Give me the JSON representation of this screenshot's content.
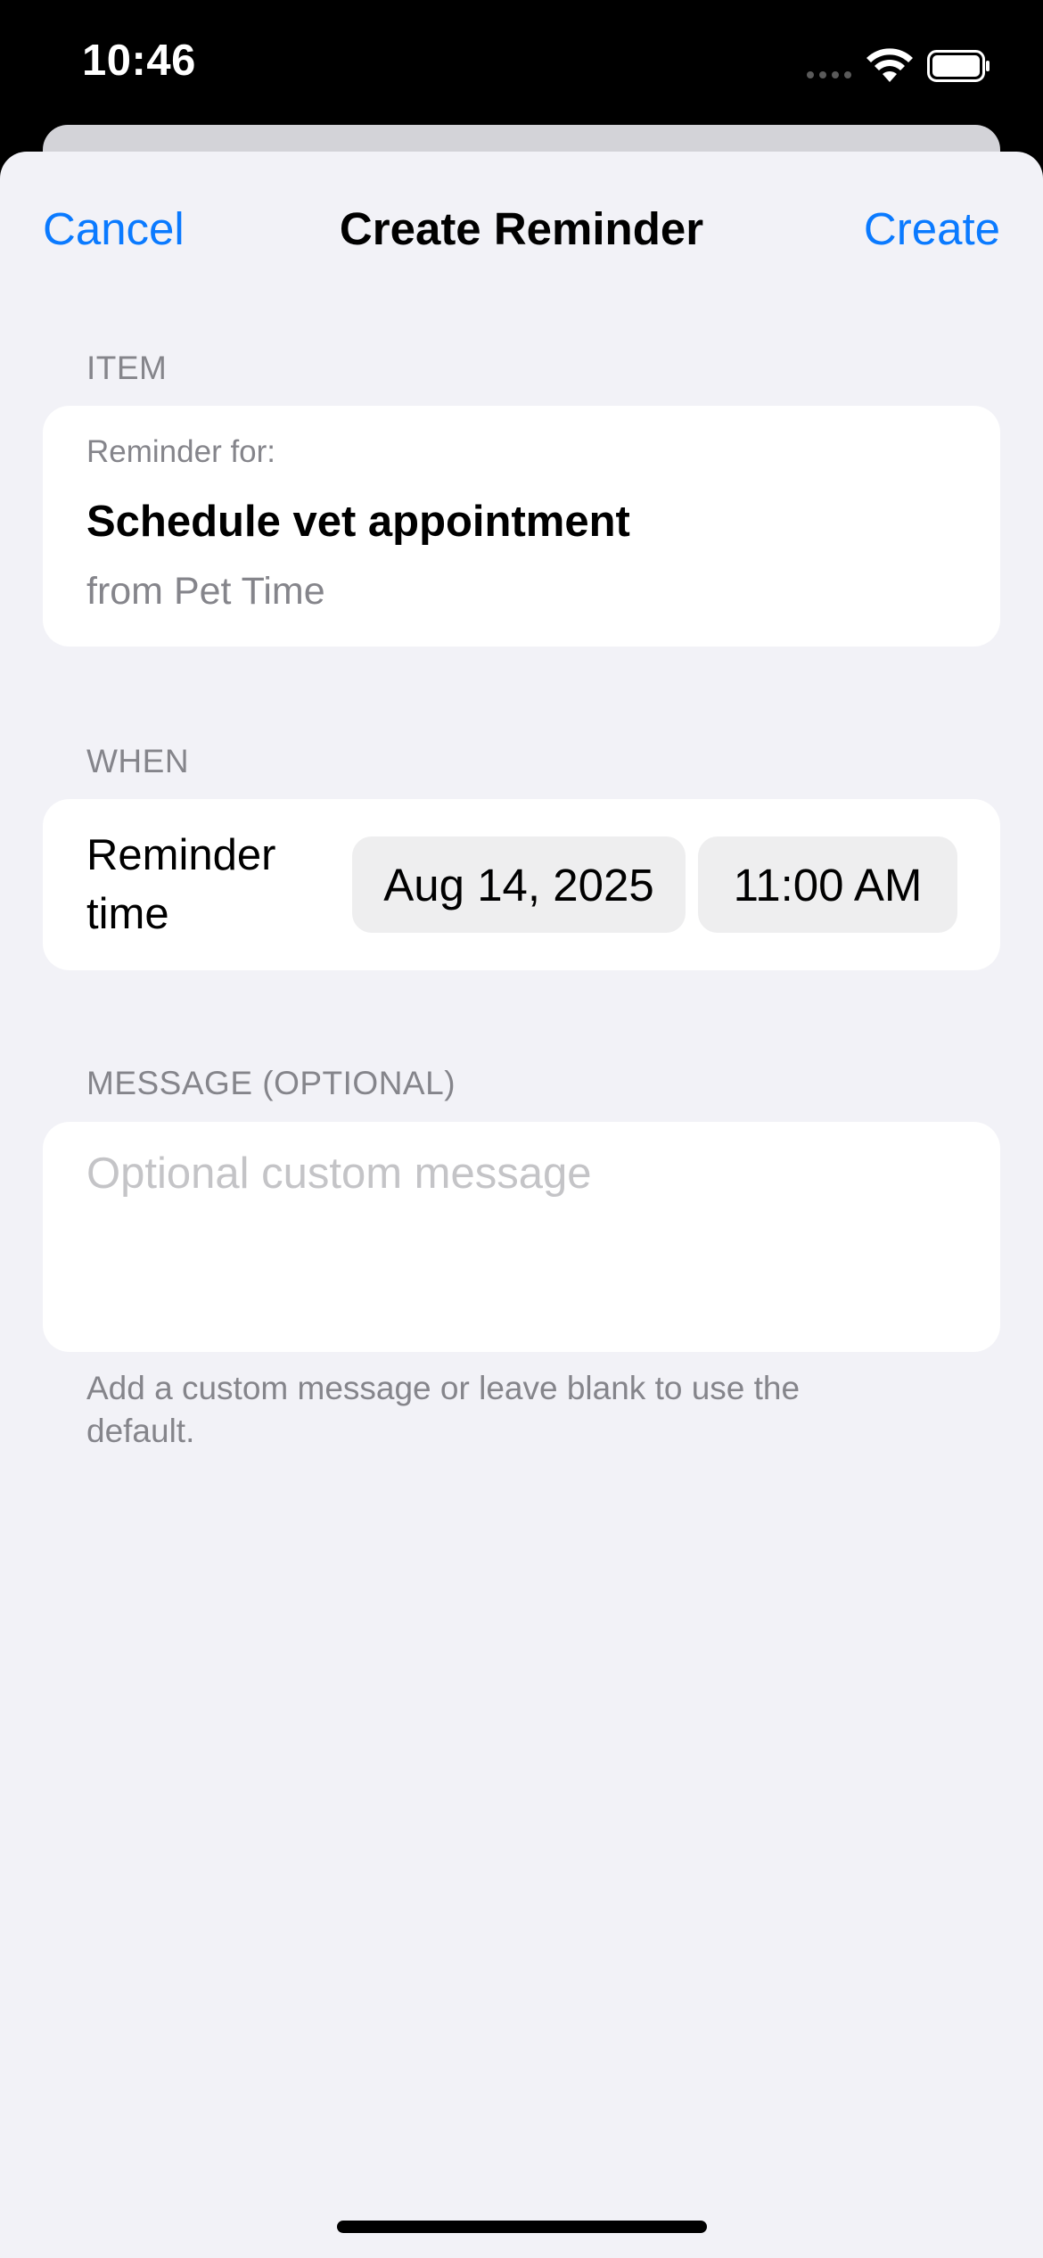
{
  "status_bar": {
    "time": "10:46",
    "icons": [
      "cellular-signal-icon",
      "wifi-icon",
      "battery-icon"
    ]
  },
  "nav": {
    "cancel_label": "Cancel",
    "title": "Create Reminder",
    "create_label": "Create"
  },
  "item_section": {
    "header": "ITEM",
    "reminder_for_label": "Reminder for:",
    "title": "Schedule vet appointment",
    "source": "from Pet Time"
  },
  "when_section": {
    "header": "WHEN",
    "label": "Reminder time",
    "date": "Aug 14, 2025",
    "time": "11:00 AM"
  },
  "message_section": {
    "header": "MESSAGE (OPTIONAL)",
    "value": "",
    "placeholder": "Optional custom message",
    "footer": "Add a custom message or leave blank to use the default."
  },
  "colors": {
    "accent": "#0A7AFF",
    "background": "#F2F2F7",
    "card": "#FFFFFF",
    "secondary_text": "#85858B",
    "placeholder_text": "#C4C4C7",
    "pill": "#EEEEEF"
  }
}
